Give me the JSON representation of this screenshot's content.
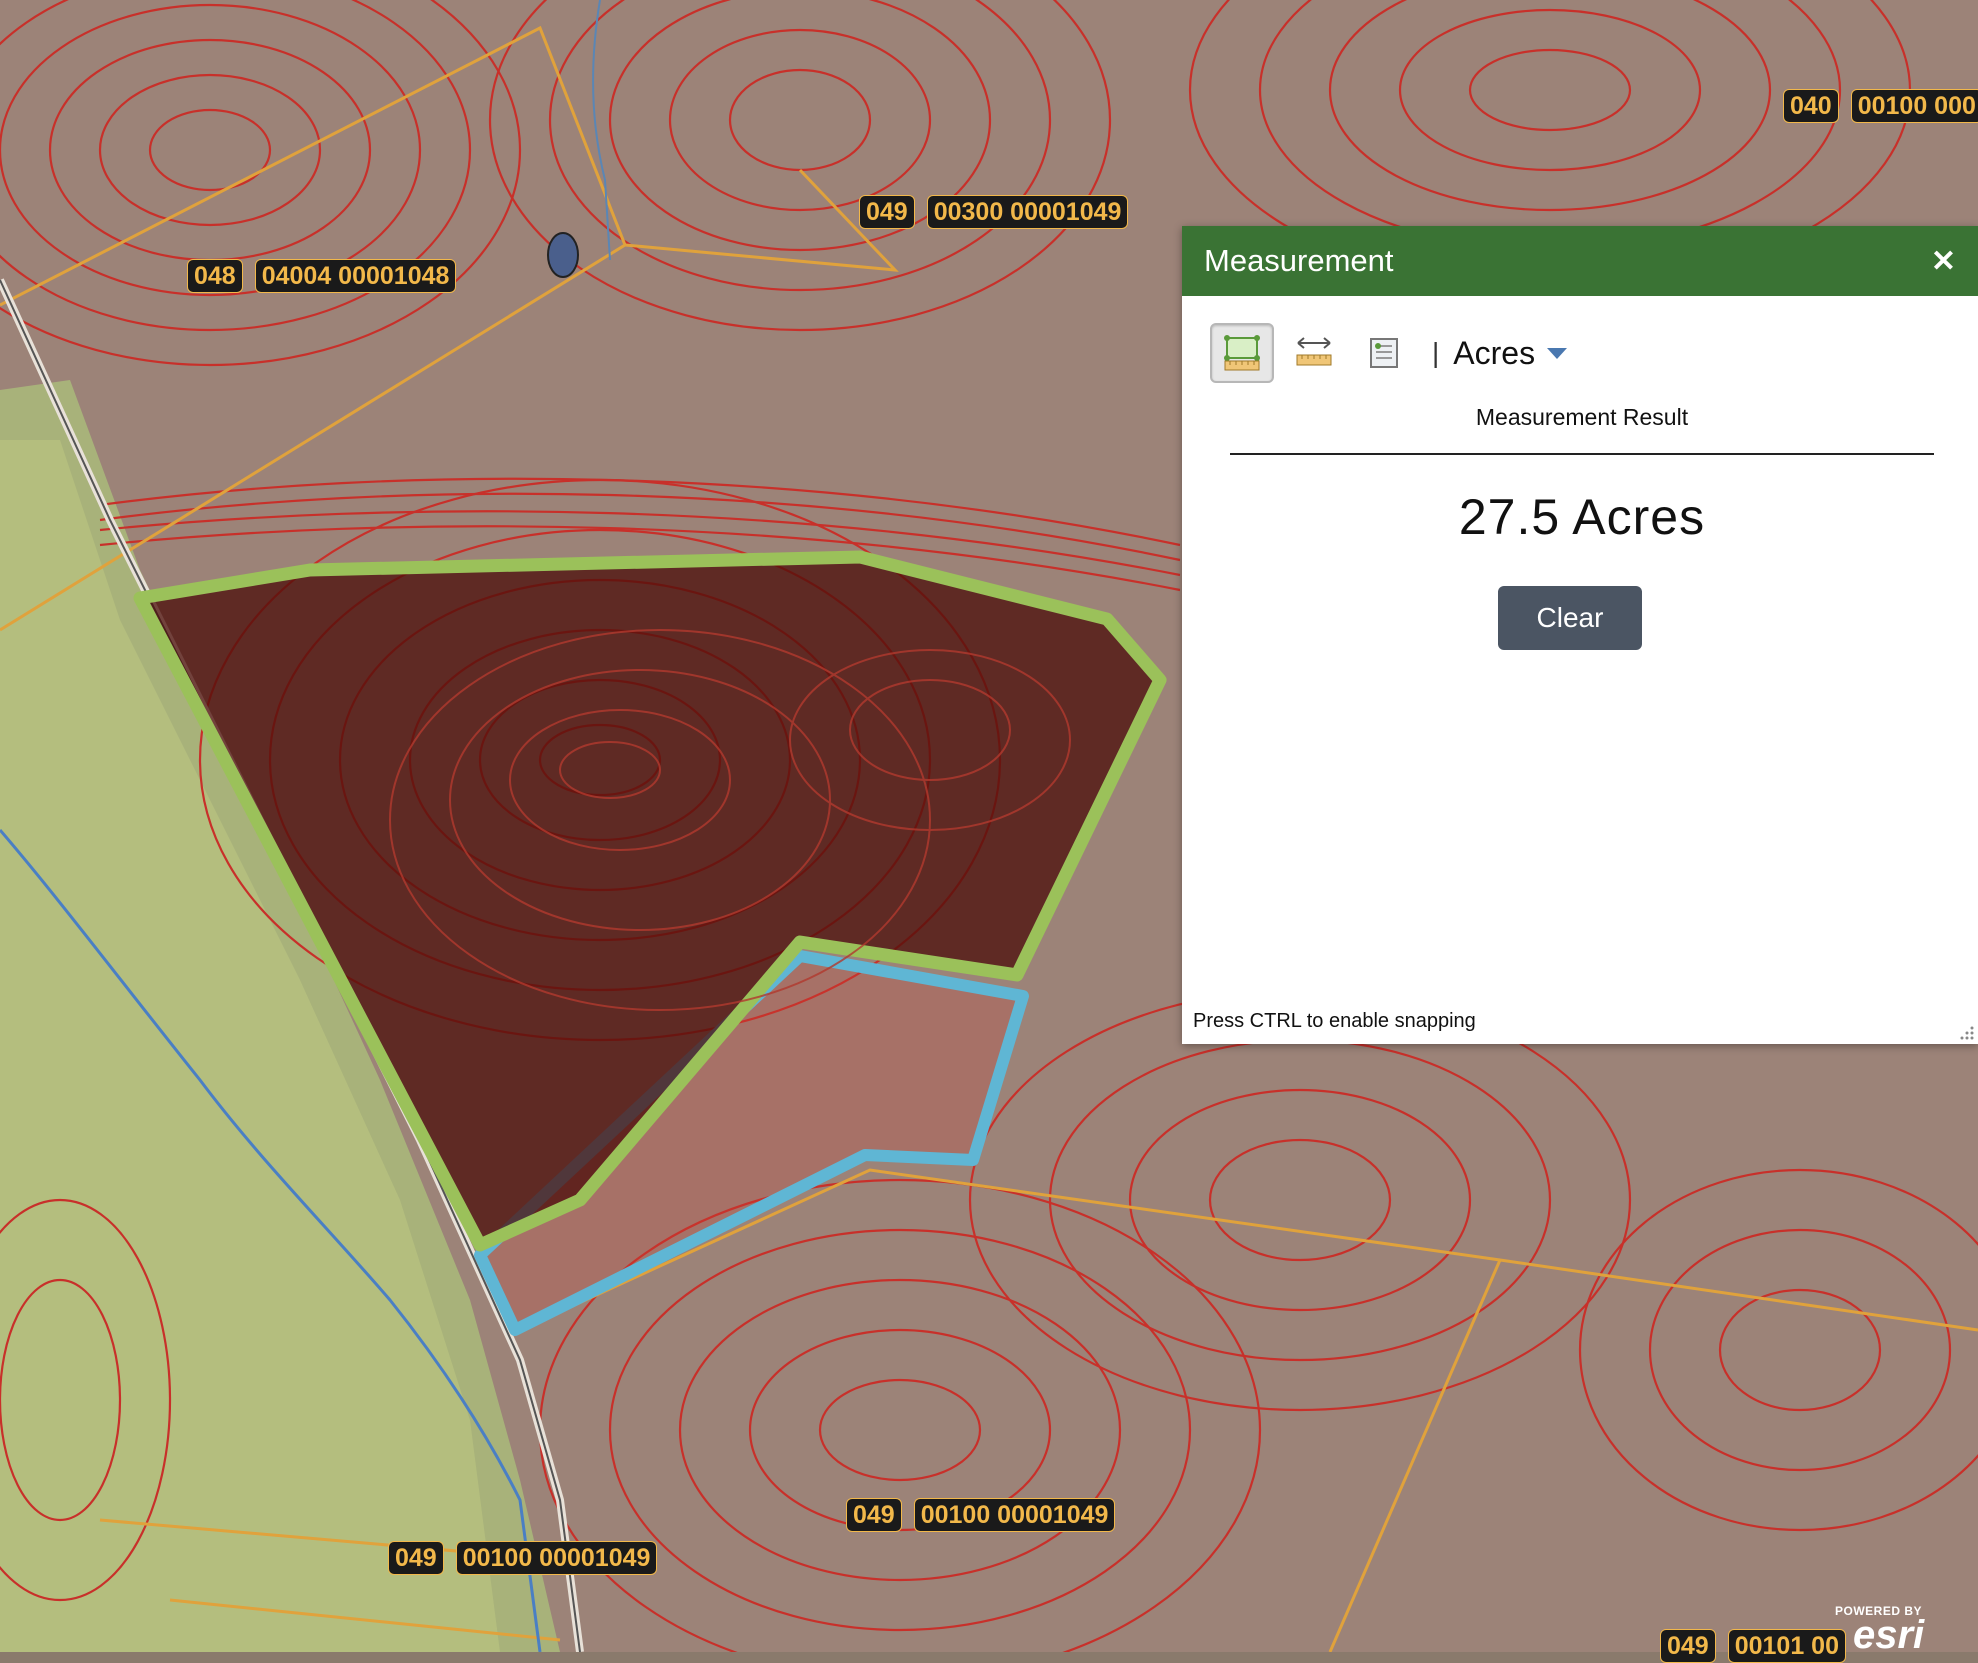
{
  "map": {
    "parcel_labels": [
      {
        "district": "040",
        "parcel": "00100 000"
      },
      {
        "district": "049",
        "parcel": "00300 00001049"
      },
      {
        "district": "048",
        "parcel": "04004 00001048"
      },
      {
        "district": "049",
        "parcel": "00100 00001049"
      },
      {
        "district": "049",
        "parcel": "00100 00001049"
      },
      {
        "district": "049",
        "parcel": "00101 00"
      }
    ],
    "colors": {
      "contour": "#c8302a",
      "parcel_line": "#e0a23c",
      "measured_outline": "#9bc15a",
      "adjacent_outline": "#5fb6d4"
    },
    "attribution": {
      "powered_by": "POWERED BY",
      "brand": "esri"
    }
  },
  "panel": {
    "title": "Measurement",
    "close_icon": "close-icon",
    "tools": [
      {
        "icon": "area-measure-icon",
        "active": true
      },
      {
        "icon": "distance-measure-icon",
        "active": false
      },
      {
        "icon": "location-icon",
        "active": false
      }
    ],
    "separator": "|",
    "unit": "Acres",
    "result_label": "Measurement Result",
    "result_value": "27.5 Acres",
    "clear_label": "Clear",
    "hint": "Press CTRL to enable snapping"
  }
}
